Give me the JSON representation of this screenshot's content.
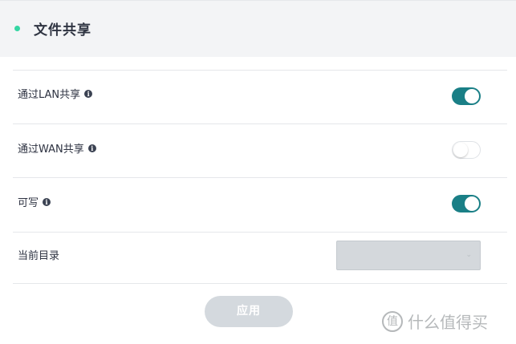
{
  "header": {
    "title": "文件共享"
  },
  "settings": [
    {
      "label": "通过LAN共享",
      "has_info": true,
      "state": "on"
    },
    {
      "label": "通过WAN共享",
      "has_info": true,
      "state": "off"
    },
    {
      "label": "可写",
      "has_info": true,
      "state": "on"
    }
  ],
  "current_dir": {
    "label": "当前目录",
    "value": ""
  },
  "apply_label": "应用",
  "watermark": {
    "text": "什么值得买",
    "logo": "值"
  },
  "colors": {
    "accent": "#1a7f86",
    "dot": "#35d6a3",
    "header_bg": "#f3f4f6",
    "disabled": "#d4d9de"
  }
}
